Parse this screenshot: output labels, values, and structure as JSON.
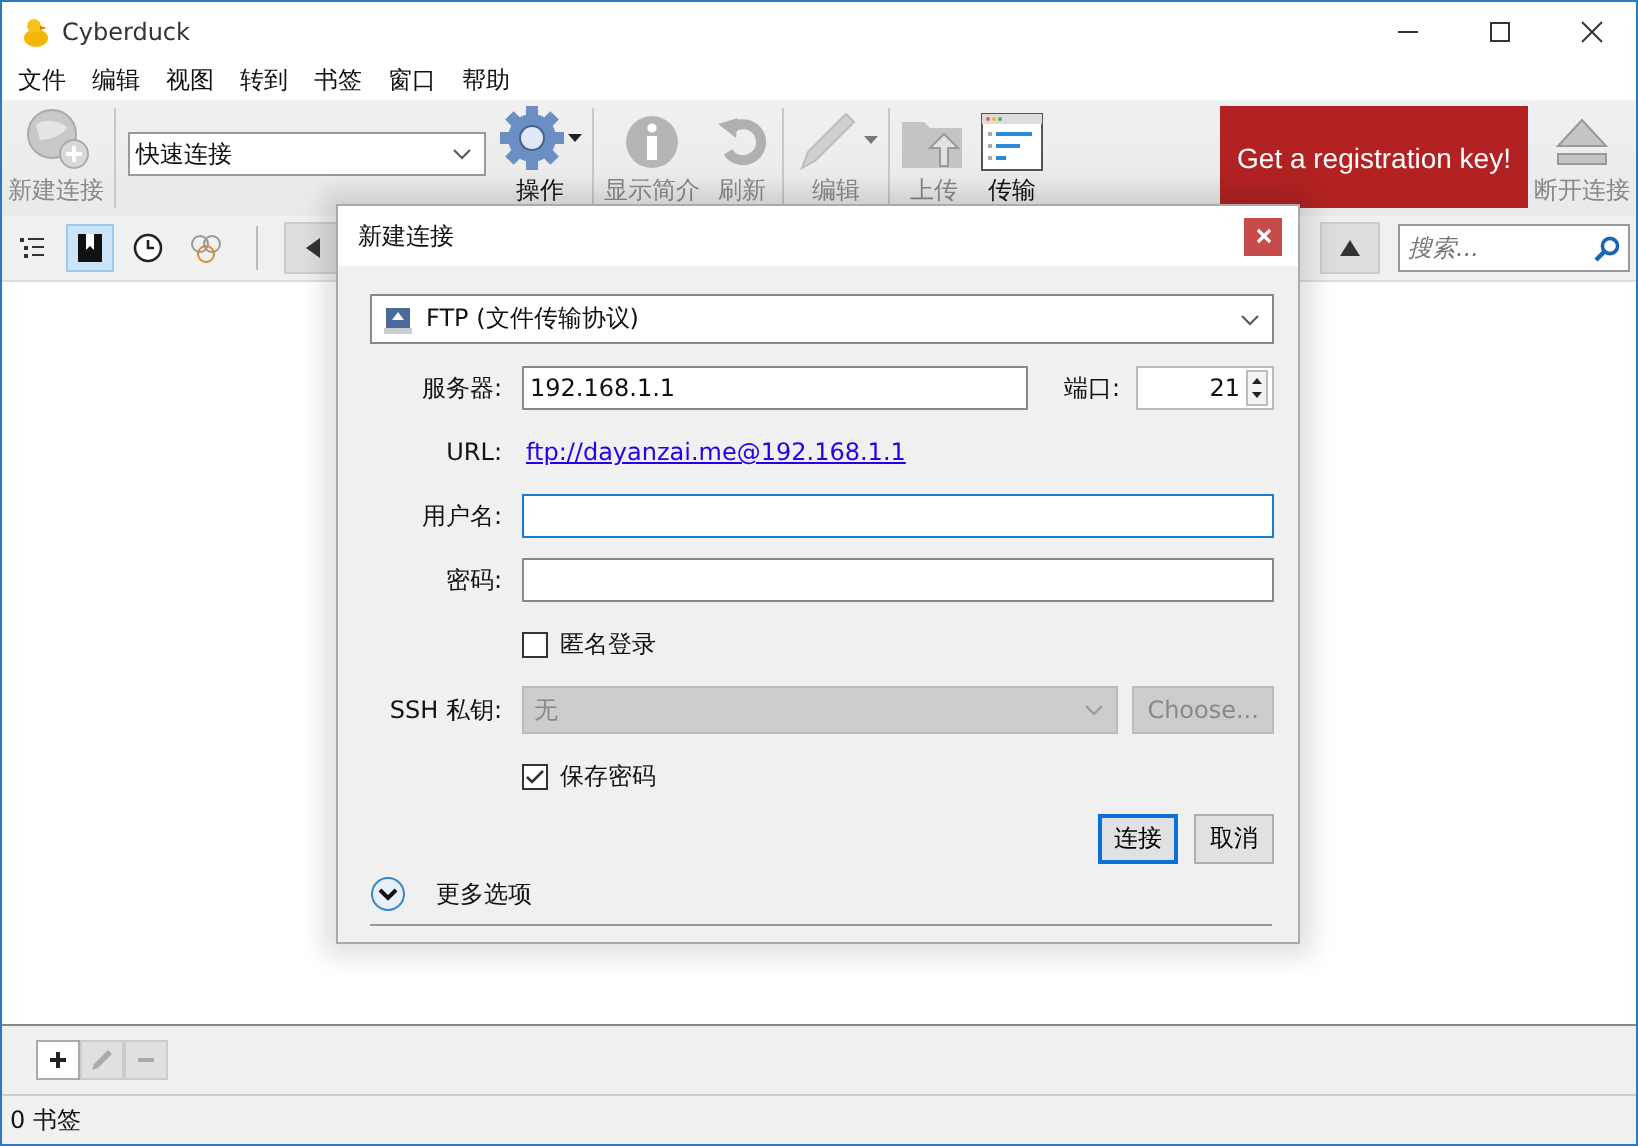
{
  "window": {
    "title": "Cyberduck"
  },
  "menu": [
    "文件",
    "编辑",
    "视图",
    "转到",
    "书签",
    "窗口",
    "帮助"
  ],
  "toolbar": {
    "new_connection": {
      "label": "新建连接",
      "disabled": true
    },
    "quick_connect": {
      "value": "快速连接"
    },
    "buttons": [
      {
        "kind": "action",
        "label": "操作",
        "disabled": false
      },
      {
        "kind": "info",
        "label": "显示简介",
        "disabled": true
      },
      {
        "kind": "refresh",
        "label": "刷新",
        "disabled": true
      },
      {
        "kind": "edit",
        "label": "编辑",
        "disabled": true
      },
      {
        "kind": "upload",
        "label": "上传",
        "disabled": true
      },
      {
        "kind": "transfers",
        "label": "传输",
        "disabled": false
      }
    ],
    "registration_button": "Get a registration key!",
    "disconnect": {
      "label": "断开连接",
      "disabled": true
    }
  },
  "view_tabs": [
    {
      "kind": "outline",
      "selected": false
    },
    {
      "kind": "bookmarks",
      "selected": true
    },
    {
      "kind": "history",
      "selected": false
    },
    {
      "kind": "bonjour",
      "selected": false
    }
  ],
  "search": {
    "placeholder": "搜索..."
  },
  "dialog": {
    "title": "新建连接",
    "protocol": "FTP (文件传输协议)",
    "server": {
      "label": "服务器:",
      "value": "192.168.1.1"
    },
    "port": {
      "label": "端口:",
      "value": "21"
    },
    "url": {
      "label": "URL:",
      "link": "ftp://dayanzai.me@192.168.1.1"
    },
    "username": {
      "label": "用户名:",
      "focused": true
    },
    "password": {
      "label": "密码:",
      "focused": false
    },
    "anonymous": {
      "label": "匿名登录",
      "checked": false
    },
    "ssh_key": {
      "label": "SSH 私钥:",
      "value": "无",
      "disabled": true,
      "choose": "Choose..."
    },
    "save_password": {
      "label": "保存密码",
      "checked": true
    },
    "buttons": [
      {
        "label": "连接",
        "default": true
      },
      {
        "label": "取消",
        "default": false
      }
    ],
    "more_options": {
      "label": "更多选项",
      "expanded": false
    }
  },
  "status_bar": "0 书签"
}
